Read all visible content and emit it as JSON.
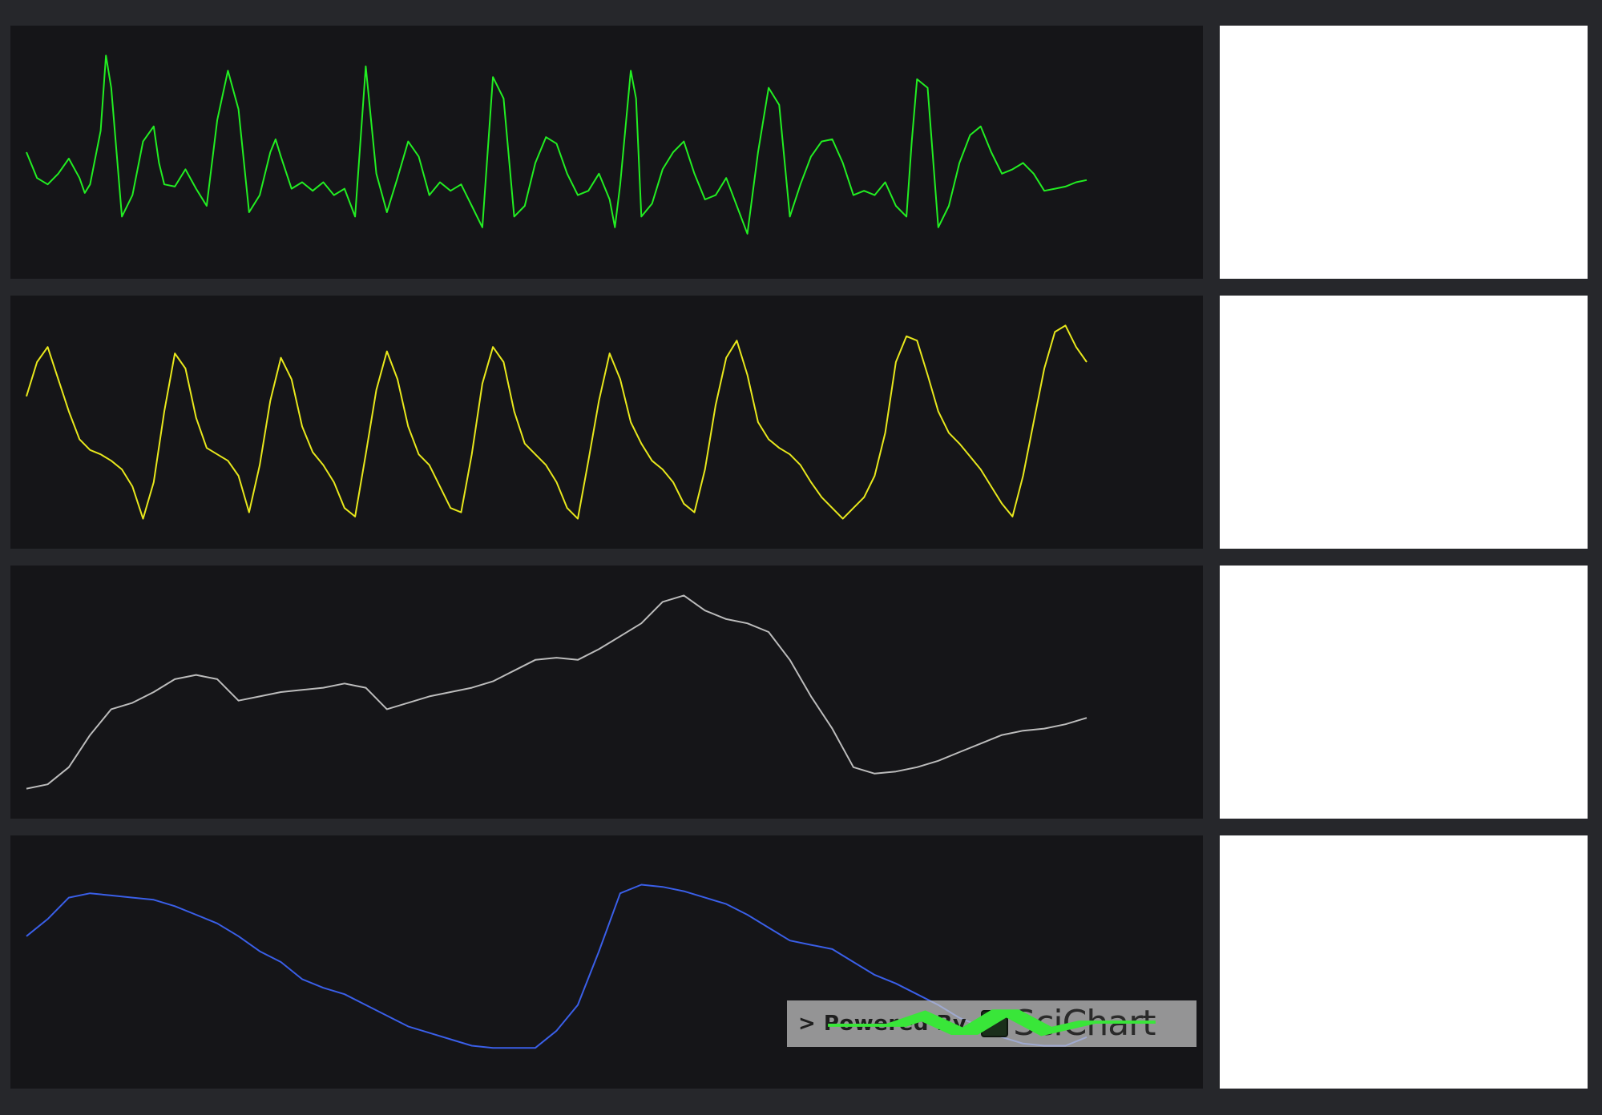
{
  "colors": {
    "background": "#26272b",
    "chart_background": "#151518",
    "side_panel": "#ffffff"
  },
  "watermark": {
    "text": "> Powered By",
    "brand": "SciChart",
    "icon": "scichart-logo-icon"
  },
  "chart_data": [
    {
      "type": "line",
      "series": [
        {
          "color": "#22ee22",
          "x": [
            0,
            0.01,
            0.02,
            0.03,
            0.04,
            0.05,
            0.055,
            0.06,
            0.07,
            0.075,
            0.08,
            0.09,
            0.1,
            0.11,
            0.12,
            0.125,
            0.13,
            0.14,
            0.15,
            0.16,
            0.17,
            0.18,
            0.19,
            0.2,
            0.21,
            0.22,
            0.23,
            0.235,
            0.24,
            0.25,
            0.26,
            0.27,
            0.28,
            0.29,
            0.3,
            0.31,
            0.32,
            0.33,
            0.34,
            0.35,
            0.36,
            0.37,
            0.38,
            0.39,
            0.4,
            0.41,
            0.42,
            0.43,
            0.435,
            0.44,
            0.45,
            0.46,
            0.47,
            0.48,
            0.49,
            0.5,
            0.51,
            0.52,
            0.53,
            0.54,
            0.55,
            0.555,
            0.56,
            0.57,
            0.575,
            0.58,
            0.59,
            0.6,
            0.61,
            0.62,
            0.63,
            0.64,
            0.65,
            0.66,
            0.67,
            0.68,
            0.69,
            0.7,
            0.71,
            0.72,
            0.73,
            0.74,
            0.75,
            0.76,
            0.77,
            0.78,
            0.79,
            0.8,
            0.81,
            0.82,
            0.83,
            0.835,
            0.84,
            0.85,
            0.86,
            0.87,
            0.88,
            0.89,
            0.9,
            0.91,
            0.92,
            0.93,
            0.94,
            0.95,
            0.96,
            0.97,
            0.98,
            0.99,
            1.0
          ],
          "y": [
            0.5,
            0.38,
            0.35,
            0.4,
            0.47,
            0.38,
            0.31,
            0.35,
            0.6,
            0.95,
            0.8,
            0.2,
            0.3,
            0.55,
            0.62,
            0.45,
            0.35,
            0.34,
            0.42,
            0.33,
            0.25,
            0.65,
            0.88,
            0.7,
            0.22,
            0.3,
            0.5,
            0.56,
            0.48,
            0.33,
            0.36,
            0.32,
            0.36,
            0.3,
            0.33,
            0.2,
            0.9,
            0.4,
            0.22,
            0.38,
            0.55,
            0.48,
            0.3,
            0.36,
            0.32,
            0.35,
            0.25,
            0.15,
            0.5,
            0.85,
            0.75,
            0.2,
            0.25,
            0.45,
            0.57,
            0.54,
            0.4,
            0.3,
            0.32,
            0.4,
            0.28,
            0.15,
            0.35,
            0.88,
            0.75,
            0.2,
            0.26,
            0.42,
            0.5,
            0.55,
            0.4,
            0.28,
            0.3,
            0.38,
            0.25,
            0.12,
            0.5,
            0.8,
            0.72,
            0.2,
            0.35,
            0.48,
            0.55,
            0.56,
            0.45,
            0.3,
            0.32,
            0.3,
            0.36,
            0.25,
            0.2,
            0.55,
            0.84,
            0.8,
            0.15,
            0.25,
            0.45,
            0.58,
            0.62,
            0.5,
            0.4,
            0.42,
            0.45,
            0.4,
            0.32,
            0.33,
            0.34,
            0.36,
            0.37
          ],
          "ylim": [
            0,
            1
          ]
        }
      ]
    },
    {
      "type": "line",
      "series": [
        {
          "color": "#e8e81c",
          "x": [
            0,
            0.01,
            0.02,
            0.03,
            0.04,
            0.05,
            0.06,
            0.07,
            0.08,
            0.09,
            0.1,
            0.11,
            0.12,
            0.13,
            0.14,
            0.15,
            0.16,
            0.17,
            0.18,
            0.19,
            0.2,
            0.21,
            0.22,
            0.23,
            0.24,
            0.25,
            0.26,
            0.27,
            0.28,
            0.29,
            0.3,
            0.31,
            0.32,
            0.33,
            0.34,
            0.35,
            0.36,
            0.37,
            0.38,
            0.39,
            0.4,
            0.41,
            0.42,
            0.43,
            0.44,
            0.45,
            0.46,
            0.47,
            0.48,
            0.49,
            0.5,
            0.51,
            0.52,
            0.53,
            0.54,
            0.55,
            0.56,
            0.57,
            0.58,
            0.59,
            0.6,
            0.61,
            0.62,
            0.63,
            0.64,
            0.65,
            0.66,
            0.67,
            0.68,
            0.69,
            0.7,
            0.71,
            0.72,
            0.73,
            0.74,
            0.75,
            0.76,
            0.77,
            0.78,
            0.79,
            0.8,
            0.81,
            0.82,
            0.83,
            0.84,
            0.85,
            0.86,
            0.87,
            0.88,
            0.89,
            0.9,
            0.91,
            0.92,
            0.93,
            0.94,
            0.95,
            0.96,
            0.97,
            0.98,
            0.99,
            1.0
          ],
          "y": [
            0.62,
            0.78,
            0.85,
            0.7,
            0.55,
            0.42,
            0.37,
            0.35,
            0.32,
            0.28,
            0.2,
            0.05,
            0.22,
            0.55,
            0.82,
            0.75,
            0.52,
            0.38,
            0.35,
            0.32,
            0.25,
            0.08,
            0.3,
            0.6,
            0.8,
            0.7,
            0.48,
            0.36,
            0.3,
            0.22,
            0.1,
            0.06,
            0.35,
            0.65,
            0.83,
            0.7,
            0.48,
            0.35,
            0.3,
            0.2,
            0.1,
            0.08,
            0.35,
            0.68,
            0.85,
            0.78,
            0.55,
            0.4,
            0.35,
            0.3,
            0.22,
            0.1,
            0.05,
            0.32,
            0.6,
            0.82,
            0.7,
            0.5,
            0.4,
            0.32,
            0.28,
            0.22,
            0.12,
            0.08,
            0.28,
            0.58,
            0.8,
            0.88,
            0.72,
            0.5,
            0.42,
            0.38,
            0.35,
            0.3,
            0.22,
            0.15,
            0.1,
            0.05,
            0.1,
            0.15,
            0.25,
            0.45,
            0.78,
            0.9,
            0.88,
            0.72,
            0.55,
            0.45,
            0.4,
            0.34,
            0.28,
            0.2,
            0.12,
            0.06,
            0.25,
            0.5,
            0.75,
            0.92,
            0.95,
            0.85,
            0.78
          ],
          "ylim": [
            0,
            1
          ]
        }
      ]
    },
    {
      "type": "line",
      "series": [
        {
          "color": "#bcbcbc",
          "x": [
            0,
            0.02,
            0.04,
            0.06,
            0.08,
            0.1,
            0.12,
            0.14,
            0.16,
            0.18,
            0.2,
            0.22,
            0.24,
            0.26,
            0.28,
            0.3,
            0.31,
            0.32,
            0.34,
            0.36,
            0.38,
            0.4,
            0.42,
            0.44,
            0.46,
            0.48,
            0.5,
            0.52,
            0.54,
            0.56,
            0.58,
            0.6,
            0.62,
            0.64,
            0.66,
            0.68,
            0.7,
            0.72,
            0.74,
            0.76,
            0.78,
            0.8,
            0.82,
            0.84,
            0.86,
            0.88,
            0.9,
            0.92,
            0.94,
            0.96,
            0.98,
            1.0
          ],
          "y": [
            0.05,
            0.07,
            0.15,
            0.3,
            0.42,
            0.45,
            0.5,
            0.56,
            0.58,
            0.56,
            0.46,
            0.48,
            0.5,
            0.51,
            0.52,
            0.54,
            0.53,
            0.52,
            0.42,
            0.45,
            0.48,
            0.5,
            0.52,
            0.55,
            0.6,
            0.65,
            0.66,
            0.65,
            0.7,
            0.76,
            0.82,
            0.92,
            0.95,
            0.88,
            0.84,
            0.82,
            0.78,
            0.65,
            0.48,
            0.33,
            0.15,
            0.12,
            0.13,
            0.15,
            0.18,
            0.22,
            0.26,
            0.3,
            0.32,
            0.33,
            0.35,
            0.38
          ],
          "ylim": [
            0,
            1
          ]
        }
      ]
    },
    {
      "type": "line",
      "series": [
        {
          "color": "#3a5fe8",
          "x": [
            0,
            0.02,
            0.04,
            0.06,
            0.08,
            0.1,
            0.12,
            0.14,
            0.16,
            0.18,
            0.2,
            0.22,
            0.24,
            0.26,
            0.28,
            0.3,
            0.32,
            0.34,
            0.36,
            0.38,
            0.4,
            0.42,
            0.44,
            0.46,
            0.48,
            0.5,
            0.52,
            0.54,
            0.56,
            0.58,
            0.6,
            0.62,
            0.64,
            0.66,
            0.68,
            0.7,
            0.72,
            0.74,
            0.76,
            0.78,
            0.8,
            0.82,
            0.84,
            0.86,
            0.88,
            0.9,
            0.92,
            0.94,
            0.96,
            0.98,
            1.0
          ],
          "y": [
            0.62,
            0.7,
            0.8,
            0.82,
            0.81,
            0.8,
            0.79,
            0.76,
            0.72,
            0.68,
            0.62,
            0.55,
            0.5,
            0.42,
            0.38,
            0.35,
            0.3,
            0.25,
            0.2,
            0.17,
            0.14,
            0.11,
            0.1,
            0.1,
            0.1,
            0.18,
            0.3,
            0.55,
            0.82,
            0.86,
            0.85,
            0.83,
            0.8,
            0.77,
            0.72,
            0.66,
            0.6,
            0.58,
            0.56,
            0.5,
            0.44,
            0.4,
            0.35,
            0.3,
            0.24,
            0.2,
            0.15,
            0.12,
            0.11,
            0.11,
            0.15
          ],
          "ylim": [
            0,
            1
          ]
        }
      ]
    }
  ]
}
